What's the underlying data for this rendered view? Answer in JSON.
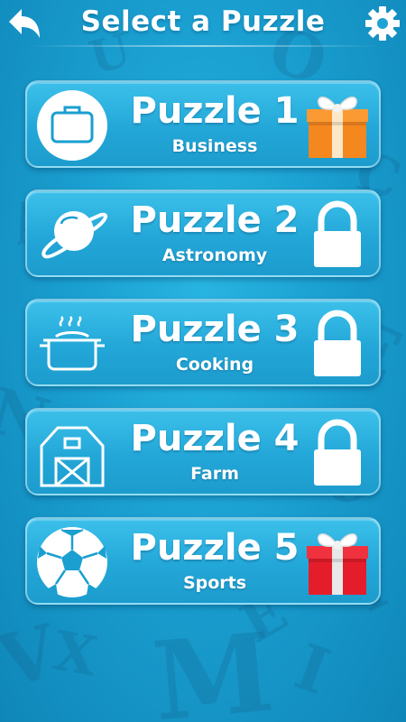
{
  "header": {
    "title": "Select a Puzzle",
    "back_icon": "back-arrow-icon",
    "settings_icon": "gear-icon"
  },
  "puzzles": [
    {
      "label": "Puzzle 1",
      "category": "Business",
      "icon": "briefcase-icon",
      "status": "gift",
      "status_color": "#f5871f"
    },
    {
      "label": "Puzzle 2",
      "category": "Astronomy",
      "icon": "planet-icon",
      "status": "locked"
    },
    {
      "label": "Puzzle 3",
      "category": "Cooking",
      "icon": "cooking-pot-icon",
      "status": "locked"
    },
    {
      "label": "Puzzle 4",
      "category": "Farm",
      "icon": "barn-icon",
      "status": "locked"
    },
    {
      "label": "Puzzle 5",
      "category": "Sports",
      "icon": "soccer-ball-icon",
      "status": "gift",
      "status_color": "#e51d2a"
    }
  ],
  "colors": {
    "background": "#1a9fd0",
    "card": "#23a7d8",
    "text": "#ffffff"
  }
}
